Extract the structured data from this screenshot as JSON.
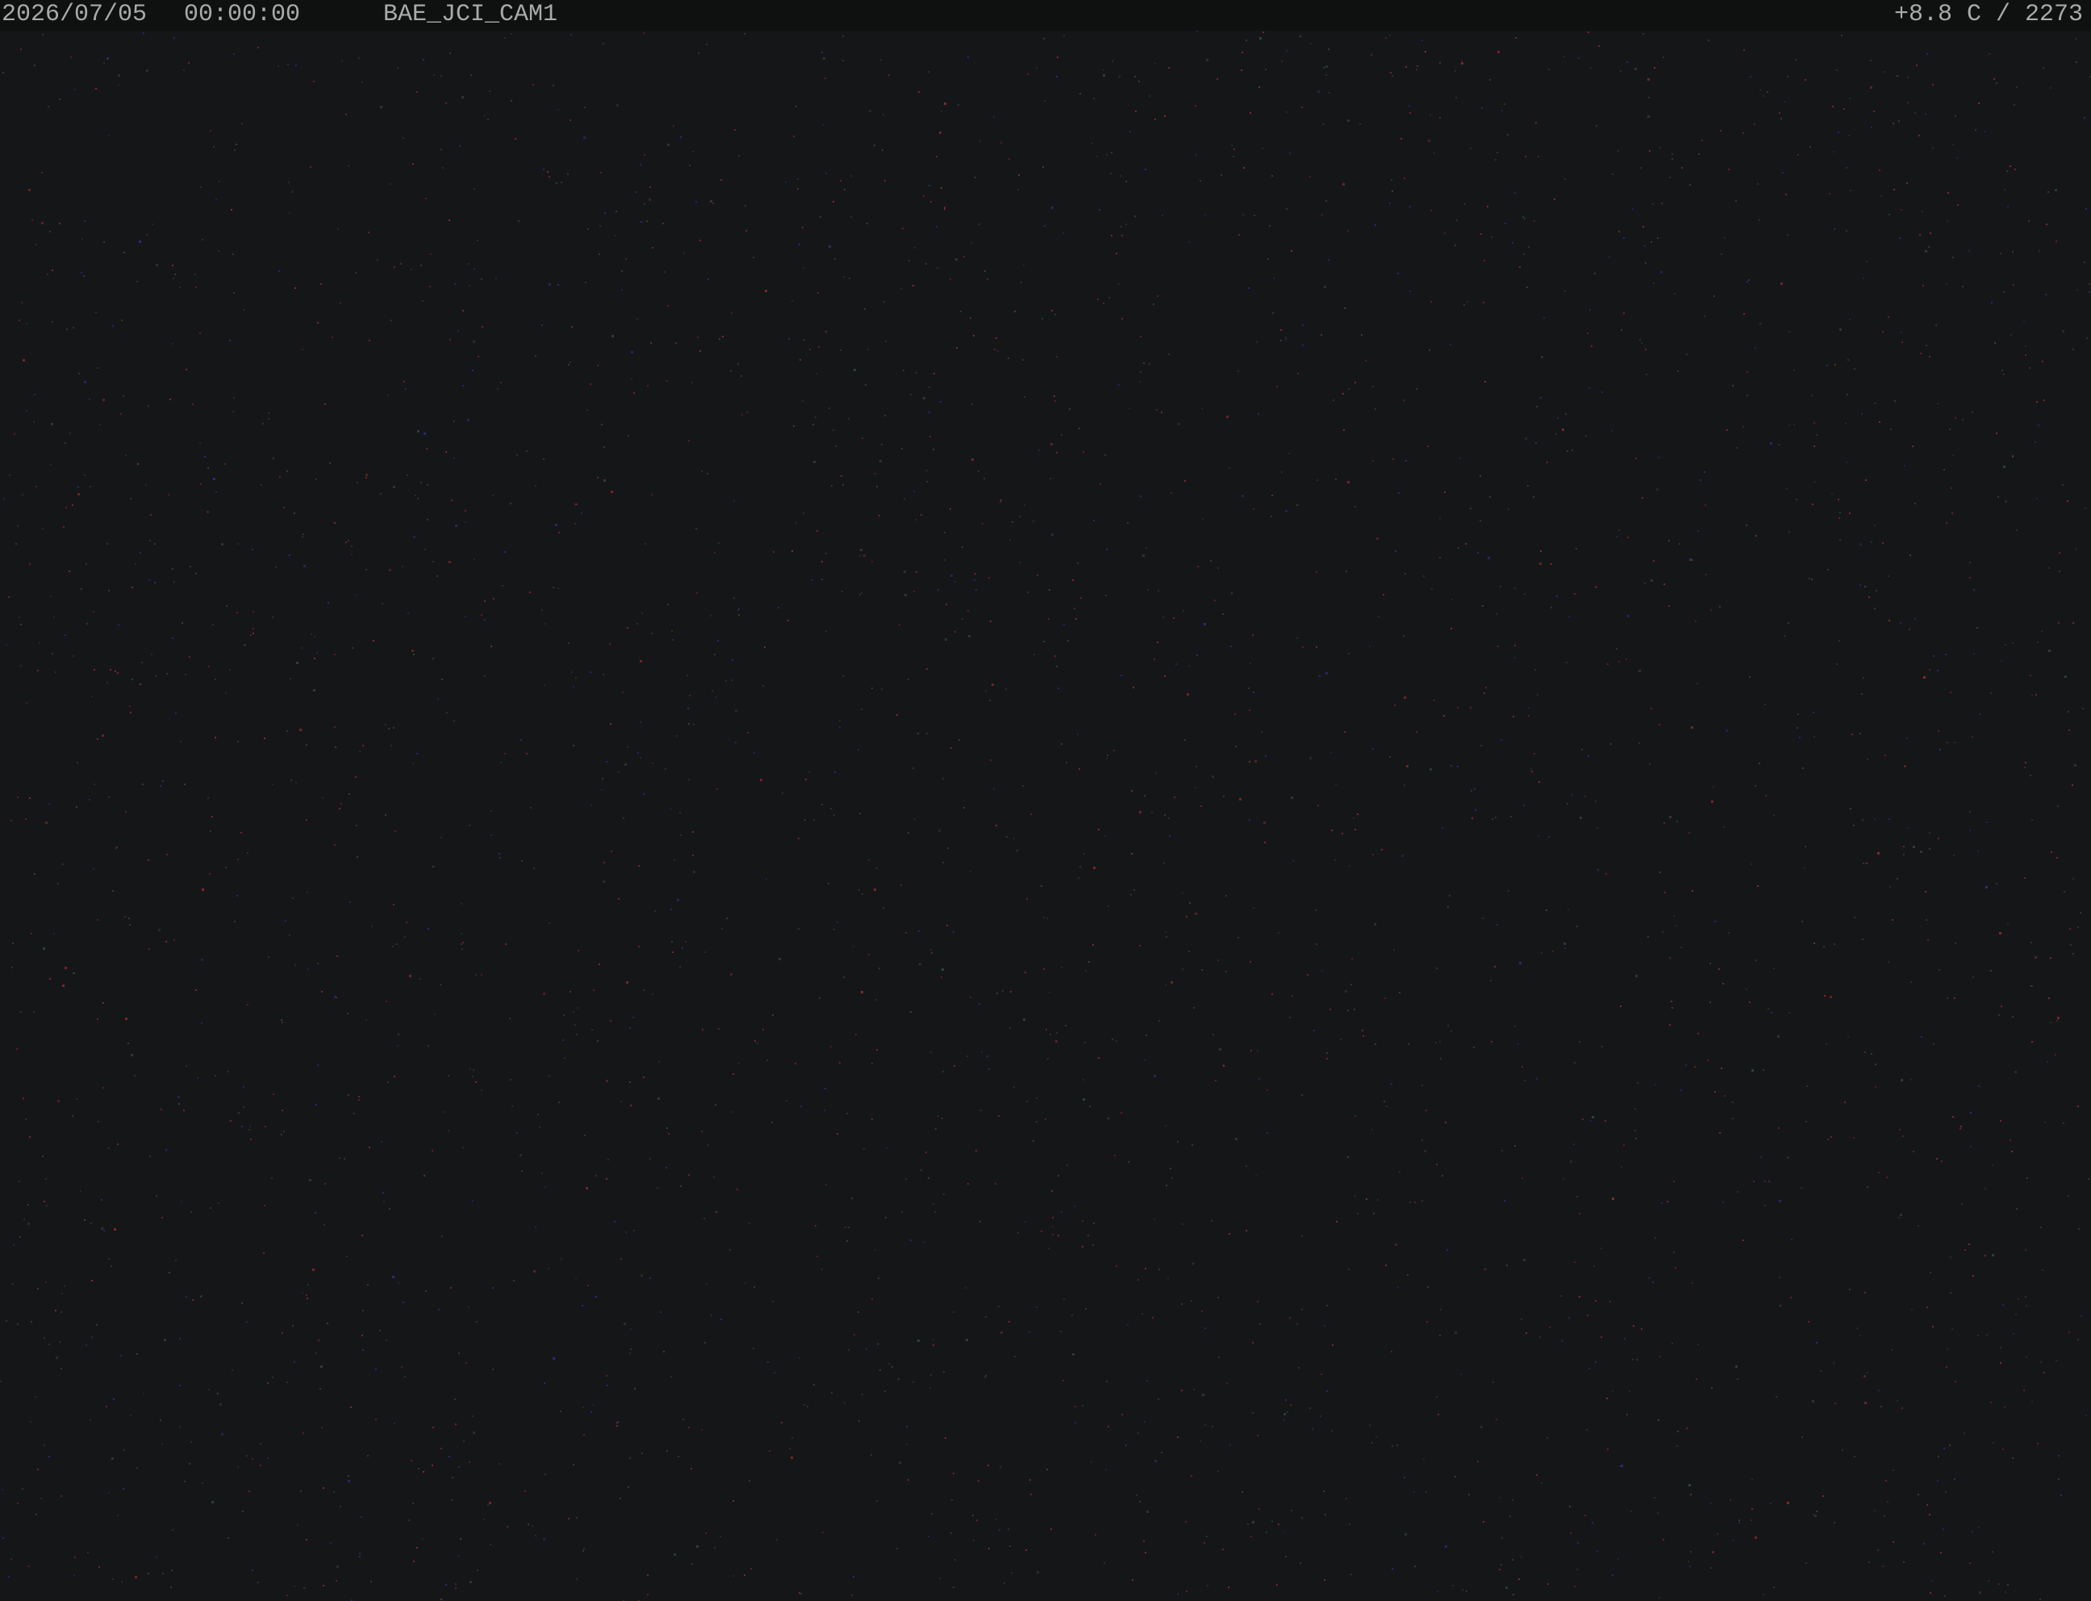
{
  "overlay": {
    "date": "2026/07/05",
    "time": "00:00:00",
    "camera_name": "BAE_JCI_CAM1",
    "temperature_and_value": "+8.8 C / 2273"
  },
  "colors": {
    "background": "#151617",
    "overlay_bar": "#0f1010",
    "overlay_text": "#a9aaa9",
    "noise_red": "#8a2a30",
    "noise_green": "#2f4a36",
    "noise_blue": "#2a2f7a",
    "noise_gray": "#3a3b3c"
  }
}
